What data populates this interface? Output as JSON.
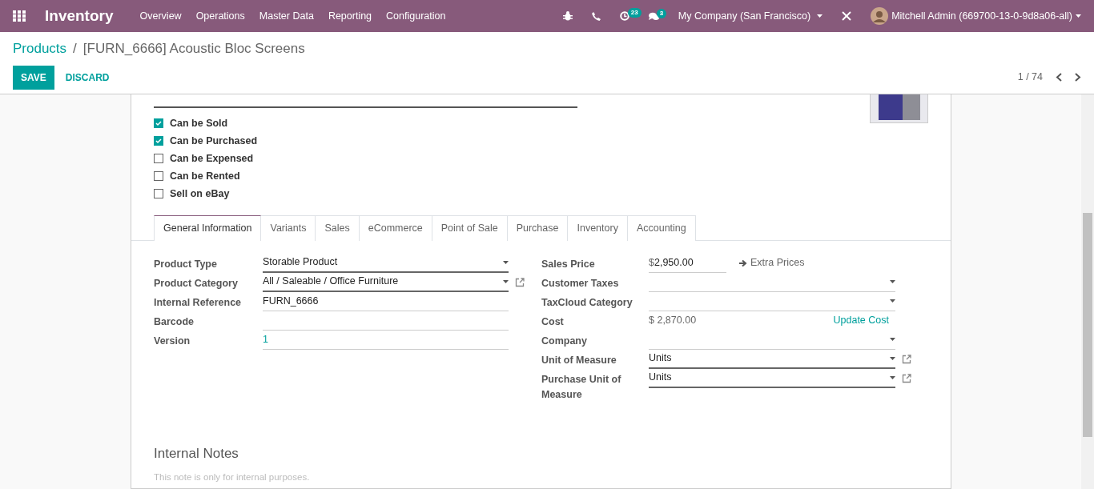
{
  "navbar": {
    "app_name": "Inventory",
    "menu": [
      "Overview",
      "Operations",
      "Master Data",
      "Reporting",
      "Configuration"
    ],
    "activity_count": "23",
    "message_count": "3",
    "company": "My Company (San Francisco)",
    "user": "Mitchell Admin (669700-13-0-9d8a06-all)"
  },
  "breadcrumb": {
    "items": [
      "Products",
      "[FURN_6666] Acoustic Bloc Screens"
    ],
    "separator": "/"
  },
  "actions": {
    "save": "SAVE",
    "discard": "DISCARD"
  },
  "pager": "1 / 74",
  "checkboxes": [
    {
      "label": "Can be Sold",
      "checked": true
    },
    {
      "label": "Can be Purchased",
      "checked": true
    },
    {
      "label": "Can be Expensed",
      "checked": false
    },
    {
      "label": "Can be Rented",
      "checked": false
    },
    {
      "label": "Sell on eBay",
      "checked": false
    }
  ],
  "tabs": [
    {
      "label": "General Information",
      "selected": true
    },
    {
      "label": "Variants",
      "selected": false
    },
    {
      "label": "Sales",
      "selected": false
    },
    {
      "label": "eCommerce",
      "selected": false
    },
    {
      "label": "Point of Sale",
      "selected": false
    },
    {
      "label": "Purchase",
      "selected": false
    },
    {
      "label": "Inventory",
      "selected": false
    },
    {
      "label": "Accounting",
      "selected": false
    }
  ],
  "left_fields": [
    {
      "label": "Product Type",
      "kind": "select",
      "value": "Storable Product",
      "required": true,
      "external_link": false
    },
    {
      "label": "Product Category",
      "kind": "select",
      "value": "All / Saleable / Office Furniture",
      "required": true,
      "external_link": true
    },
    {
      "label": "Internal Reference",
      "kind": "text",
      "value": "FURN_6666",
      "required": false,
      "external_link": false
    },
    {
      "label": "Barcode",
      "kind": "text",
      "required": false,
      "external_link": false
    },
    {
      "label": "Version",
      "kind": "number",
      "value": "1",
      "required": false,
      "external_link": false
    }
  ],
  "right_fields": [
    {
      "label": "Sales Price",
      "kind": "monetary",
      "currency": "$",
      "value": "2,950.00",
      "link": "Extra Prices",
      "external_link": false
    },
    {
      "label": "Customer Taxes",
      "kind": "select",
      "required": false,
      "external_link": false
    },
    {
      "label": "TaxCloud Category",
      "kind": "select",
      "required": false,
      "external_link": false
    },
    {
      "label": "Cost",
      "kind": "readonly",
      "value": "$ 2,870.00",
      "link": "Update Cost",
      "external_link": false
    },
    {
      "label": "Company",
      "kind": "select",
      "required": false,
      "external_link": false
    },
    {
      "label": "Unit of Measure",
      "kind": "select",
      "value": "Units",
      "required": true,
      "external_link": true
    },
    {
      "label": "Purchase Unit of Measure",
      "kind": "select",
      "value": "Units",
      "required": true,
      "external_link": true
    }
  ],
  "notes": {
    "title": "Internal Notes",
    "placeholder": "This note is only for internal purposes."
  }
}
